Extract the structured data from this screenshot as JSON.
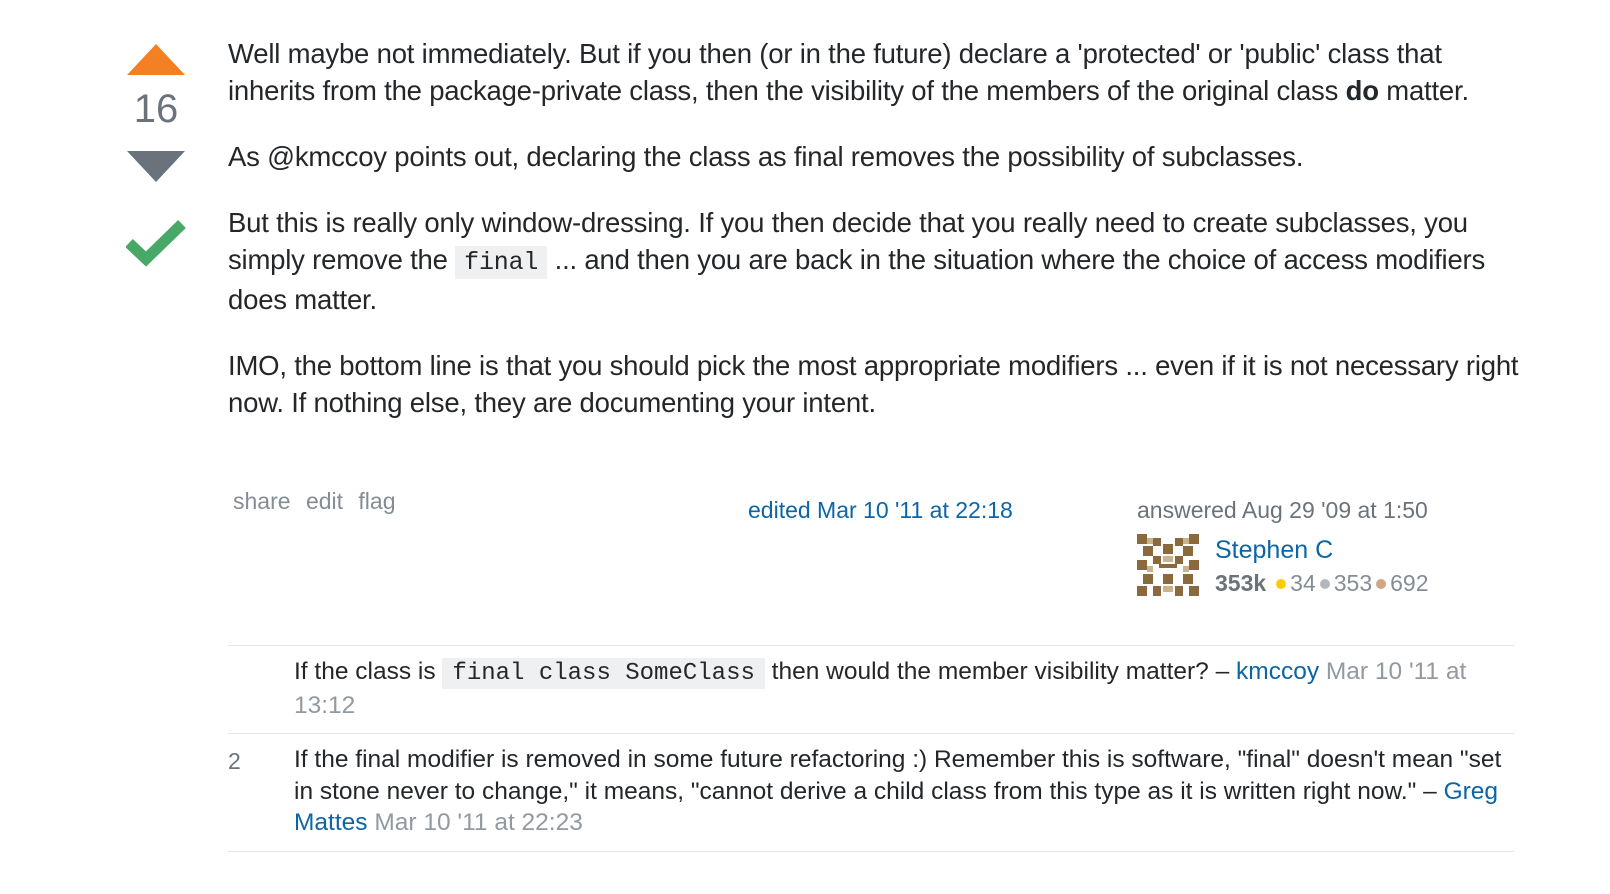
{
  "votes": {
    "count": "16",
    "upvote_color": "#f48024",
    "downvote_color": "#6a737c",
    "accepted_color": "#48a868",
    "accepted": true
  },
  "post": {
    "p1_before": "Well maybe not immediately. But if you then (or in the future) declare a 'protected' or 'public' class that inherits from the package-private class, then the visibility of the members of the original class ",
    "p1_bold": "do",
    "p1_after": " matter.",
    "p2": "As @kmccoy points out, declaring the class as final removes the possibility of subclasses.",
    "p3_before": "But this is really only window-dressing. If you then decide that you really need to create subclasses, you simply remove the ",
    "p3_code": "final",
    "p3_after": " ... and then you are back in the situation where the choice of access modifiers does matter.",
    "p4": "IMO, the bottom line is that you should pick the most appropriate modifiers ... even if it is not necessary right now. If nothing else, they are documenting your intent."
  },
  "menu": {
    "share": "share",
    "edit": "edit",
    "flag": "flag"
  },
  "edited": "edited Mar 10 '11 at 22:18",
  "answered": "answered Aug 29 '09 at 1:50",
  "user": {
    "name": "Stephen C",
    "reputation": "353k",
    "gold": "34",
    "silver": "353",
    "bronze": "692",
    "gold_color": "#ffcc01",
    "silver_color": "#b4b8bc",
    "bronze_color": "#d1a684",
    "avatar_icon": "identicon-avatar"
  },
  "comments": [
    {
      "score": "",
      "text_before": "If the class is ",
      "code": "final class SomeClass",
      "text_after": " then would the member visibility matter? – ",
      "user": "kmccoy",
      "date": "Mar 10 '11 at 13:12"
    },
    {
      "score": "2",
      "text": "If the final modifier is removed in some future refactoring :) Remember this is software, \"final\" doesn't mean \"set in stone never to change,\" it means, \"cannot derive a child class from this type as it is written right now.\" – ",
      "user": "Greg Mattes",
      "date": "Mar 10 '11 at 22:23"
    }
  ]
}
